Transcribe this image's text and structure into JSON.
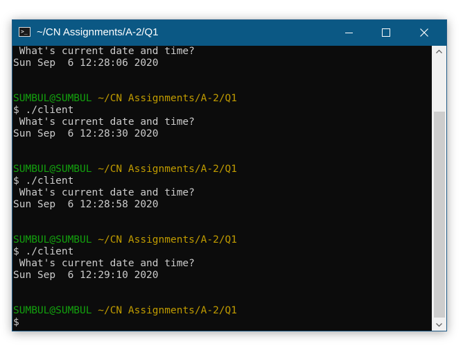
{
  "window": {
    "title": "~/CN Assignments/A-2/Q1",
    "app_icon": "terminal-app-icon",
    "buttons": {
      "minimize": "minimize-icon",
      "maximize": "maximize-icon",
      "close": "close-icon"
    }
  },
  "colors": {
    "titlebar": "#0b5884",
    "terminal_bg": "#0c0c0c",
    "terminal_text": "#cccccc",
    "user_host": "#13a10e",
    "path": "#c19c00"
  },
  "terminal": {
    "lines": [
      {
        "text": " What's current date and time?"
      },
      {
        "text": "Sun Sep  6 12:28:06 2020"
      },
      {
        "text": ""
      },
      {
        "text": ""
      },
      {
        "user": "SUMBUL@SUMBUL",
        "path": " ~/CN Assignments/A-2/Q1"
      },
      {
        "text": "$ ./client"
      },
      {
        "text": " What's current date and time?"
      },
      {
        "text": "Sun Sep  6 12:28:30 2020"
      },
      {
        "text": ""
      },
      {
        "text": ""
      },
      {
        "user": "SUMBUL@SUMBUL",
        "path": " ~/CN Assignments/A-2/Q1"
      },
      {
        "text": "$ ./client"
      },
      {
        "text": " What's current date and time?"
      },
      {
        "text": "Sun Sep  6 12:28:58 2020"
      },
      {
        "text": ""
      },
      {
        "text": ""
      },
      {
        "user": "SUMBUL@SUMBUL",
        "path": " ~/CN Assignments/A-2/Q1"
      },
      {
        "text": "$ ./client"
      },
      {
        "text": " What's current date and time?"
      },
      {
        "text": "Sun Sep  6 12:29:10 2020"
      },
      {
        "text": ""
      },
      {
        "text": ""
      },
      {
        "user": "SUMBUL@SUMBUL",
        "path": " ~/CN Assignments/A-2/Q1"
      },
      {
        "text": "$"
      }
    ]
  },
  "scrollbar": {
    "up_icon": "scroll-up-arrow-icon",
    "down_icon": "scroll-down-arrow-icon"
  }
}
